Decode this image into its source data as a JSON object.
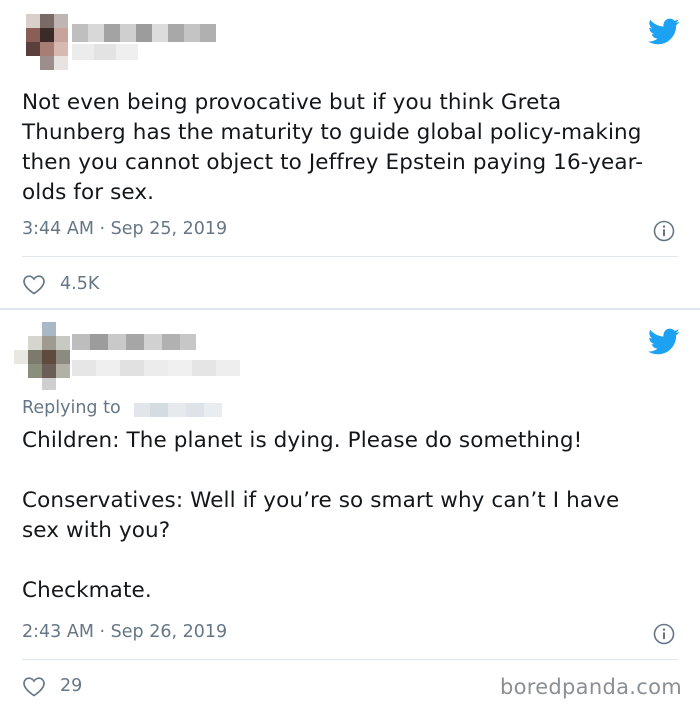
{
  "tweets": [
    {
      "body": "Not even being provocative but if you think Greta Thunberg has the maturity to guide global policy-making then you cannot object to Jeffrey Epstein paying 16-year-olds for sex.",
      "time": "3:44 AM",
      "date": "Sep 25, 2019",
      "likes": "4.5K"
    },
    {
      "replying_to": "Replying to",
      "body_lines": [
        "Children: The planet is dying. Please do something!",
        "Conservatives: Well if you’re so smart why can’t I have sex with you?",
        "Checkmate."
      ],
      "time": "2:43 AM",
      "date": "Sep 26, 2019",
      "likes": "29"
    }
  ],
  "meta_separator": "·",
  "watermark": "boredpanda.com",
  "colors": {
    "twitter_blue": "#1da1f2",
    "meta_gray": "#657786",
    "text": "#14171a",
    "divider": "#e1e8ed"
  },
  "icons": [
    "twitter-bird-icon",
    "info-icon",
    "heart-icon"
  ]
}
